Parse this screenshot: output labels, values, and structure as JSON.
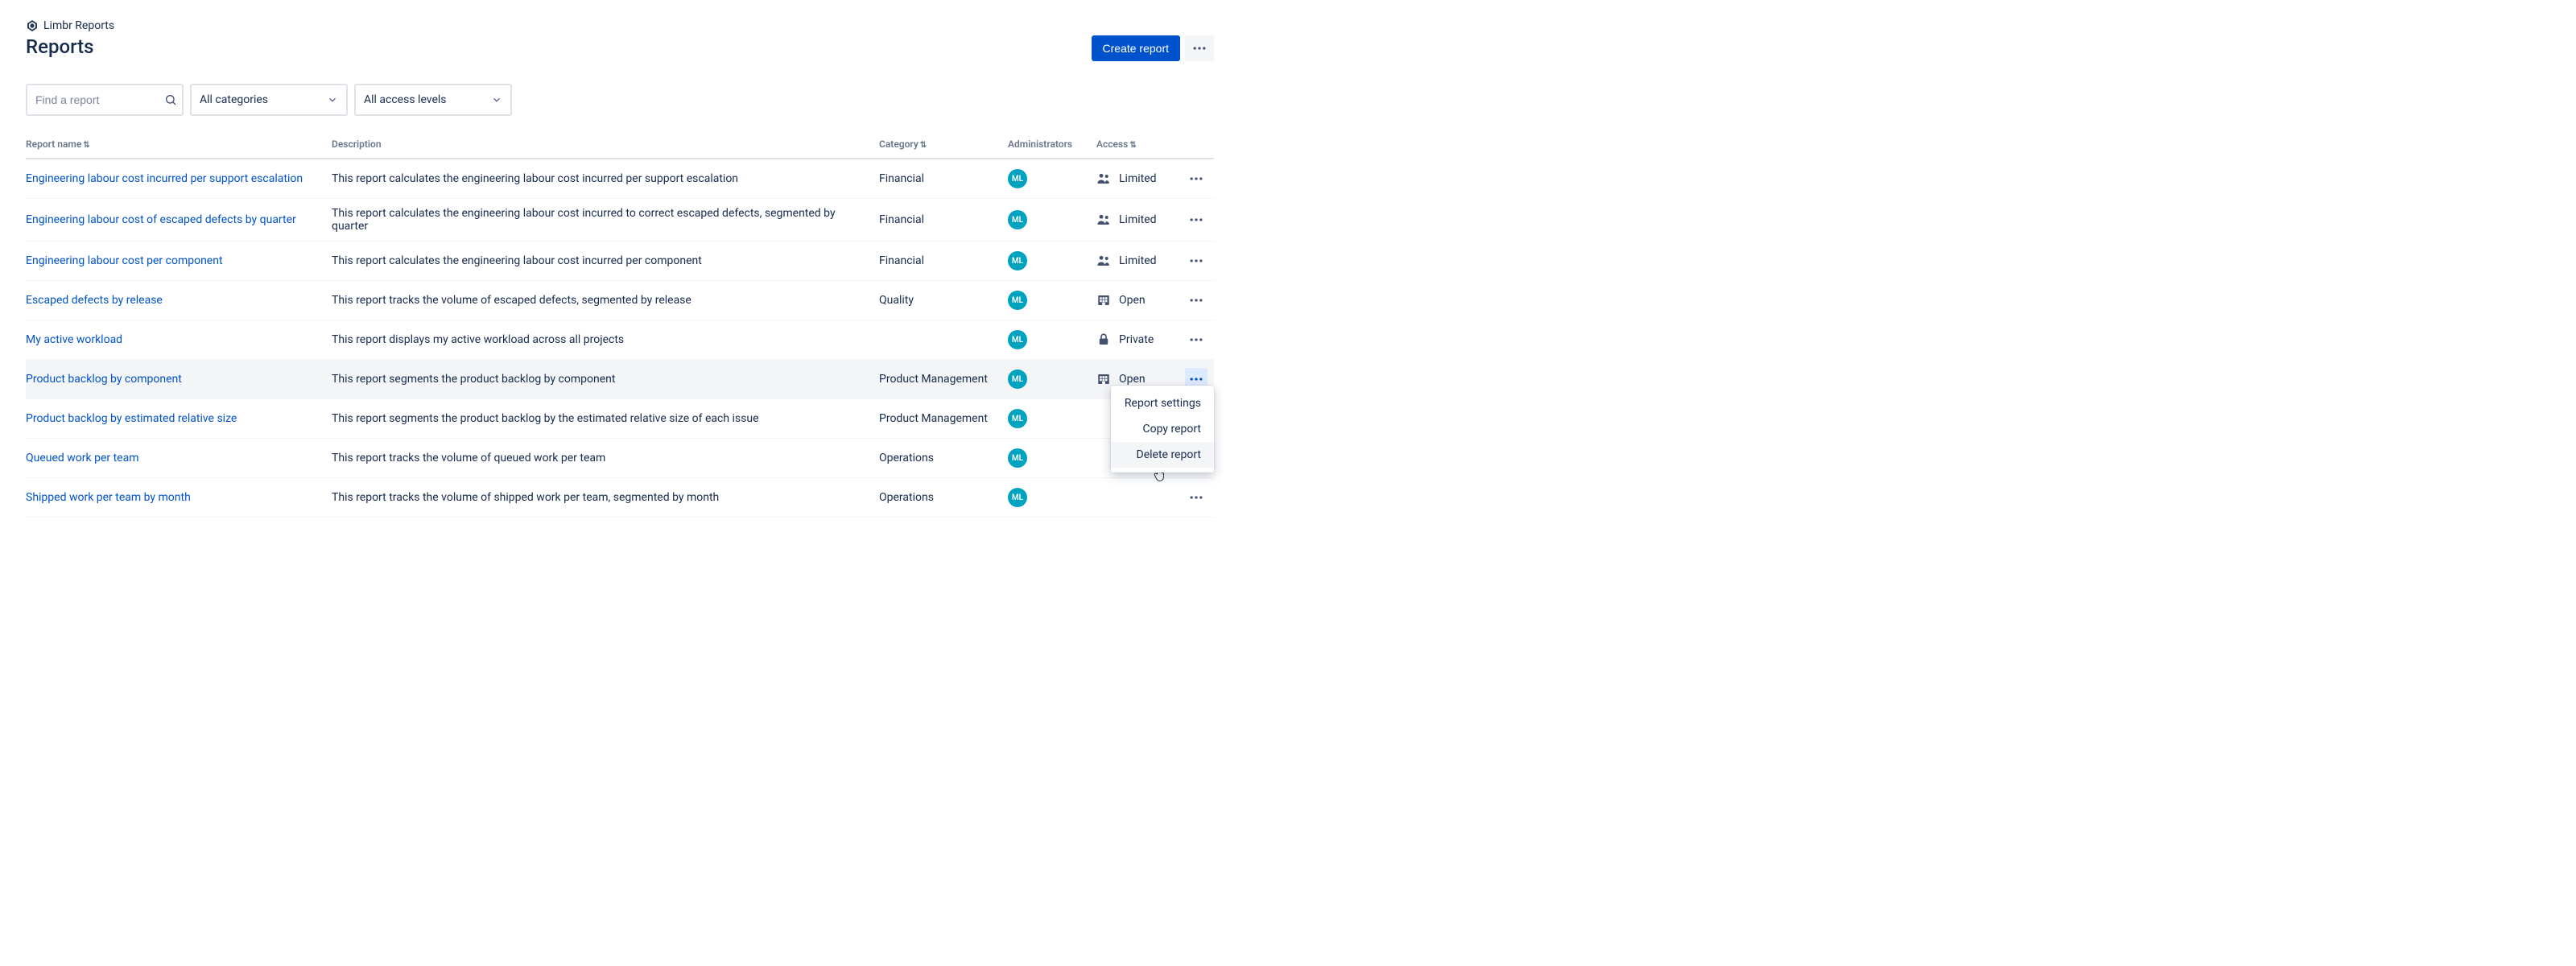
{
  "breadcrumb": "Limbr Reports",
  "page_title": "Reports",
  "header": {
    "create_label": "Create report"
  },
  "filters": {
    "search_placeholder": "Find a report",
    "category_select": "All categories",
    "access_select": "All access levels"
  },
  "columns": {
    "name": "Report name",
    "description": "Description",
    "category": "Category",
    "administrators": "Administrators",
    "access": "Access"
  },
  "avatar_initials": "ML",
  "access_labels": {
    "limited": "Limited",
    "open": "Open",
    "private": "Private"
  },
  "rows": [
    {
      "name": "Engineering labour cost incurred per support escalation",
      "description": "This report calculates the engineering labour cost incurred per support escalation",
      "category": "Financial",
      "access": "limited"
    },
    {
      "name": "Engineering labour cost of escaped defects by quarter",
      "description": "This report calculates the engineering labour cost incurred to correct escaped defects, segmented by quarter",
      "category": "Financial",
      "access": "limited"
    },
    {
      "name": "Engineering labour cost per component",
      "description": "This report calculates the engineering labour cost incurred per component",
      "category": "Financial",
      "access": "limited"
    },
    {
      "name": "Escaped defects by release",
      "description": "This report tracks the volume of escaped defects, segmented by release",
      "category": "Quality",
      "access": "open"
    },
    {
      "name": "My active workload",
      "description": "This report displays my active workload across all projects",
      "category": "",
      "access": "private"
    },
    {
      "name": "Product backlog by component",
      "description": "This report segments the product backlog by component",
      "category": "Product Management",
      "access": "open",
      "highlight": true,
      "menu_open": true
    },
    {
      "name": "Product backlog by estimated relative size",
      "description": "This report segments the product backlog by the estimated relative size of each issue",
      "category": "Product Management",
      "access": ""
    },
    {
      "name": "Queued work per team",
      "description": "This report tracks the volume of queued work per team",
      "category": "Operations",
      "access": ""
    },
    {
      "name": "Shipped work per team by month",
      "description": "This report tracks the volume of shipped work per team, segmented by month",
      "category": "Operations",
      "access": ""
    }
  ],
  "row_menu": {
    "settings": "Report settings",
    "copy": "Copy report",
    "delete": "Delete report"
  }
}
